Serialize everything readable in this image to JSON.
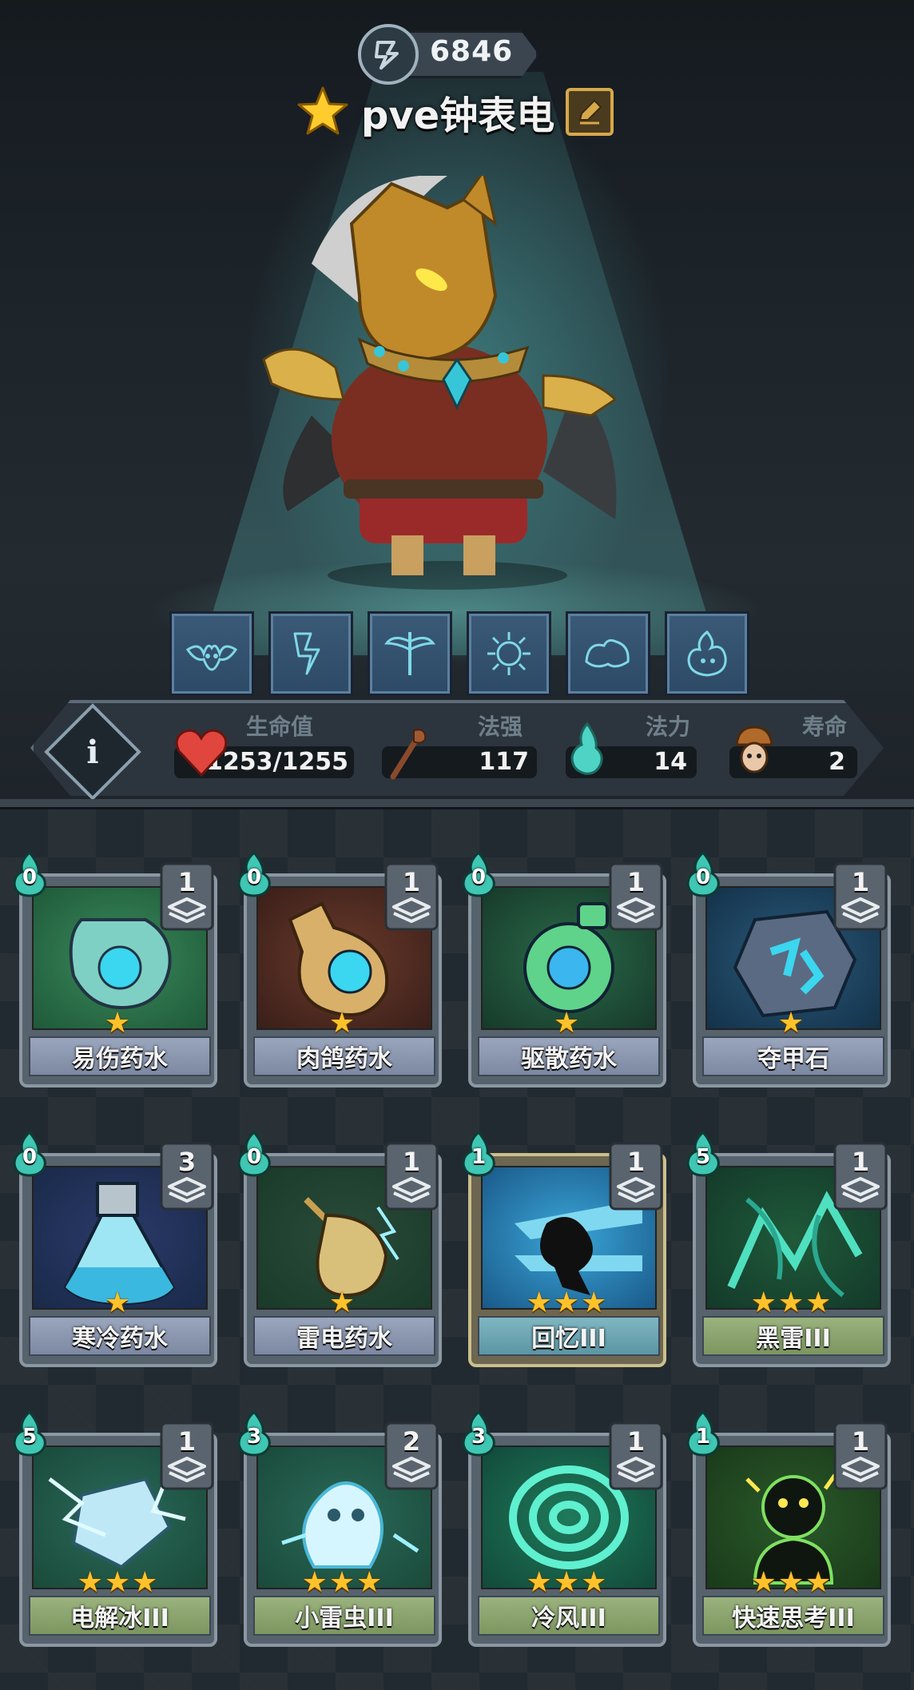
{
  "header": {
    "power_value": "6846",
    "hero_name": "pve钟表电"
  },
  "runes": [
    {
      "icon": "bat-demon-icon"
    },
    {
      "icon": "lightning-crack-icon"
    },
    {
      "icon": "winged-staff-icon"
    },
    {
      "icon": "orb-burst-icon"
    },
    {
      "icon": "muscle-arm-icon"
    },
    {
      "icon": "flame-beast-icon"
    }
  ],
  "stats": {
    "hp": {
      "label": "生命值",
      "value": "1253/1255"
    },
    "spell_power": {
      "label": "法强",
      "value": "117"
    },
    "mana": {
      "label": "法力",
      "value": "14"
    },
    "lifespan": {
      "label": "寿命",
      "value": "2"
    }
  },
  "colors": {
    "star": "#ffc22b",
    "mana_drop": "#3fc7b4",
    "card_label_potion": "#8e9ab3",
    "card_label_spell": "#8ca574",
    "card_label_teal": "#6ea6b2"
  },
  "cards": [
    {
      "name": "易伤药水",
      "cost": "0",
      "count": "1",
      "stars": 1,
      "art": "vulnerable-potion",
      "label_style": "potion"
    },
    {
      "name": "肉鸽药水",
      "cost": "0",
      "count": "1",
      "stars": 1,
      "art": "roguelike-potion",
      "label_style": "potion"
    },
    {
      "name": "驱散药水",
      "cost": "0",
      "count": "1",
      "stars": 1,
      "art": "dispel-potion",
      "label_style": "potion"
    },
    {
      "name": "夺甲石",
      "cost": "0",
      "count": "1",
      "stars": 1,
      "art": "armor-steal-stone",
      "label_style": "potion"
    },
    {
      "name": "寒冷药水",
      "cost": "0",
      "count": "3",
      "stars": 1,
      "art": "cold-potion",
      "label_style": "potion"
    },
    {
      "name": "雷电药水",
      "cost": "0",
      "count": "1",
      "stars": 1,
      "art": "thunder-potion",
      "label_style": "potion"
    },
    {
      "name": "回忆III",
      "cost": "1",
      "count": "1",
      "stars": 3,
      "art": "recall",
      "label_style": "teal"
    },
    {
      "name": "黑雷III",
      "cost": "5",
      "count": "1",
      "stars": 3,
      "art": "black-thunder",
      "label_style": "spell"
    },
    {
      "name": "电解冰III",
      "cost": "5",
      "count": "1",
      "stars": 3,
      "art": "electro-ice",
      "label_style": "spell"
    },
    {
      "name": "小雷虫III",
      "cost": "3",
      "count": "2",
      "stars": 3,
      "art": "thunder-bug",
      "label_style": "spell"
    },
    {
      "name": "冷风III",
      "cost": "3",
      "count": "1",
      "stars": 3,
      "art": "cold-wind",
      "label_style": "spell"
    },
    {
      "name": "快速思考III",
      "cost": "1",
      "count": "1",
      "stars": 3,
      "art": "quick-think",
      "label_style": "spell"
    }
  ]
}
